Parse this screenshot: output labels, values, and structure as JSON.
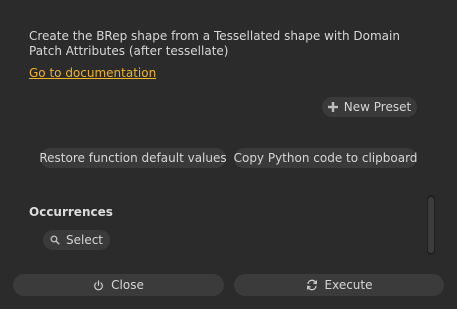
{
  "description": {
    "text": "Create the BRep shape from a Tessellated shape with Domain Patch Attributes (after tessellate)"
  },
  "documentation_link": "Go to documentation",
  "presets": {
    "new_preset_label": "New Preset"
  },
  "actions": {
    "restore_label": "Restore function default values",
    "copy_python_label": "Copy Python code to clipboard"
  },
  "occurrences": {
    "title": "Occurrences",
    "select_label": "Select"
  },
  "footer": {
    "close_label": "Close",
    "execute_label": "Execute"
  },
  "colors": {
    "background": "#2b2b2b",
    "button": "#3a3a3a",
    "link": "#f0b429",
    "text": "#d6d6d6"
  },
  "icons": {
    "new_preset": "plus-icon",
    "select": "search-icon",
    "close": "power-icon",
    "execute": "refresh-icon"
  }
}
